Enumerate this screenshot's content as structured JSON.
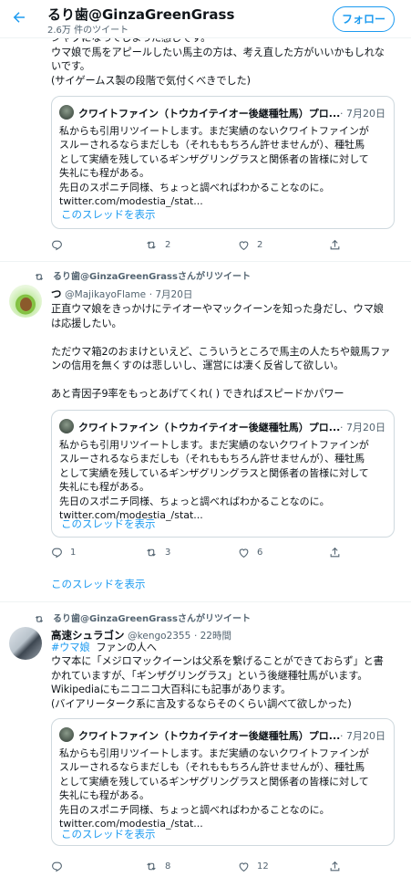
{
  "header": {
    "title": "るり歯@GinzaGreenGrass",
    "subtitle": "2.6万 件のツイート",
    "follow_label": "フォロー"
  },
  "quote_tweet": {
    "author": "クワイトファイン（トウカイテイオー後継種牡馬）プロ...",
    "date": "· 7月20日",
    "body": "私からも引用リツイートします。まだ実績のないクワイトファインが\nスルーされるならまだしも（それももちろん許せませんが）、種牡馬\nとして実績を残しているギンザグリングラスと関係者の皆様に対して\n失礼にも程がある。\n先日のスポニチ同様、ちょっと調べればわかることなのに。\ntwitter.com/modestia_/stat...",
    "show_thread": "このスレッドを表示"
  },
  "tweet0": {
    "text": "シャクになってしまった感じです。\nウマ娘で馬をアピールしたい馬主の方は、考え直した方がいいかもしれな\nいです。\n(サイゲームス製の段階で気付くべきでした)",
    "replies": "",
    "retweets": "2",
    "likes": "2"
  },
  "tweet1": {
    "retweet_label": "るり歯@GinzaGreenGrassさんがリツイート",
    "name": "つ",
    "handle": "@MajikayoFlame",
    "date": "· 7月20日",
    "text": "正直ウマ娘をきっかけにテイオーやマックイーンを知った身だし、ウマ娘\nは応援したい。\n\nただウマ箱2のおまけといえど、こういうところで馬主の人たちや競馬ファ\nンの信用を無くすのは悲しいし、運営には凄く反省して欲しい。\n\nあと青因子9率をもっとあげてくれ( ) できればスピードかパワー",
    "replies": "1",
    "retweets": "3",
    "likes": "6",
    "show_thread": "このスレッドを表示"
  },
  "tweet2": {
    "retweet_label": "るり歯@GinzaGreenGrassさんがリツイート",
    "name": "高速シュラゴン",
    "handle": "@kengo2355",
    "date": "· 22時間",
    "hashtag": "#ウマ娘",
    "hashtag_rest": "  ファンの人へ",
    "text": "ウマ本に「メジロマックイーンは父系を繋げることができておらず」と書\nかれていますが、「ギンザグリングラス」という後継種牡馬がいます。\nWikipediaにもニコニコ大百科にも記事があります。\n(バイアリーターク系に言及するならそのくらい調べて欲しかった)",
    "replies": "",
    "retweets": "8",
    "likes": "12"
  },
  "icons": {
    "back": "arrow-left-icon",
    "reply": "reply-icon",
    "retweet": "retweet-icon",
    "like": "heart-icon",
    "share": "share-icon"
  },
  "colors": {
    "accent": "#1d9bf0",
    "text": "#0f1419",
    "secondary": "#536471",
    "border": "#cfd9de"
  }
}
